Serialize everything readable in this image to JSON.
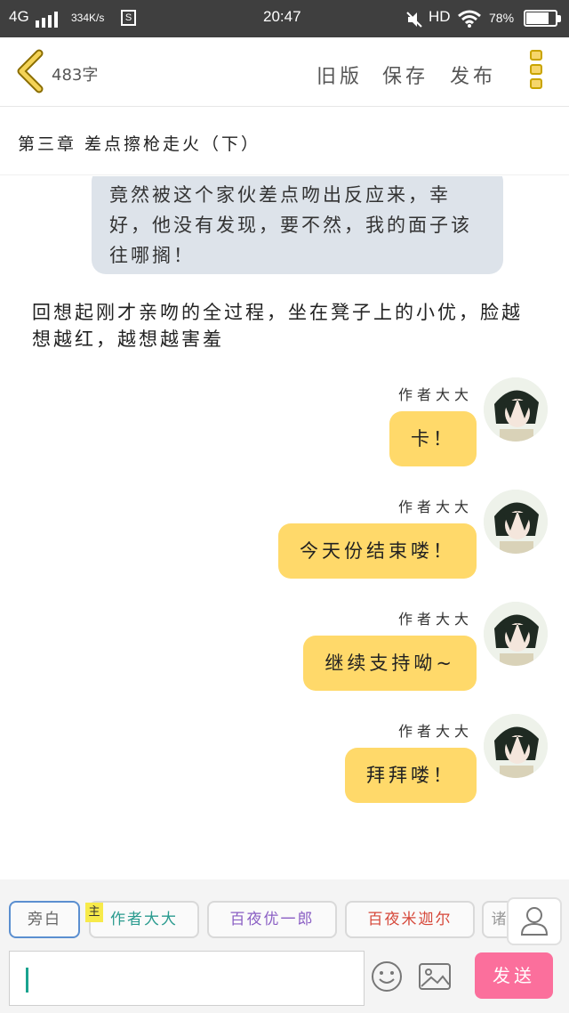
{
  "status_bar": {
    "carrier": "4G",
    "speed": "334K/s",
    "s_badge": "S",
    "time": "20:47",
    "network": "HD",
    "battery_percent": "78%",
    "battery_level": 0.78
  },
  "header": {
    "word_count": "483字",
    "old_version": "旧版",
    "save": "保存",
    "publish": "发布"
  },
  "chapter_title": "第三章 差点擦枪走火（下）",
  "narration_bubble": "竟然被这个家伙差点吻出反应来，幸好，他没有发现，要不然，我的面子该往哪搁！",
  "narration_text": "回想起刚才亲吻的全过程，坐在凳子上的小优，脸越想越红，越想越害羞",
  "messages": [
    {
      "name": "作者大大",
      "text": "卡！"
    },
    {
      "name": "作者大大",
      "text": "今天份结束喽！"
    },
    {
      "name": "作者大大",
      "text": "继续支持呦~"
    },
    {
      "name": "作者大大",
      "text": "拜拜喽！"
    }
  ],
  "roles": {
    "narrator": "旁白",
    "author": "作者大大",
    "main_tag": "主",
    "role3": "百夜优一郎",
    "role4": "百夜米迦尔",
    "role5": "诸"
  },
  "input": {
    "send": "发送"
  },
  "colors": {
    "bubble": "#ffd96a",
    "narration_bubble": "#dde3ea",
    "send_button": "#fb6f9c",
    "status_bar": "#3f3f3f"
  }
}
